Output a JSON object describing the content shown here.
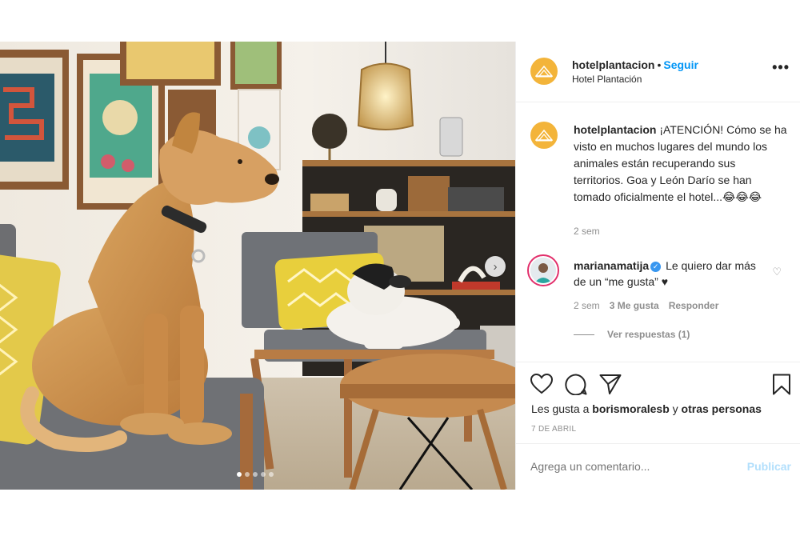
{
  "post": {
    "username": "hotelplantacion",
    "separator": "•",
    "follow_label": "Seguir",
    "location": "Hotel Plantación",
    "more_icon": "more-options-icon"
  },
  "caption": {
    "username": "hotelplantacion",
    "text": "¡ATENCIÓN! Cómo se ha visto en muchos lugares del mundo los animales están recuperando sus territorios. Goa y León Darío se han tomado oficialmente el hotel...😂😂😂",
    "time": "2 sem"
  },
  "comment": {
    "username": "marianamatija",
    "text": "Le quiero dar más de un “me gusta” ♥",
    "time": "2 sem",
    "likes": "3 Me gusta",
    "reply": "Responder",
    "view_replies": "Ver respuestas (1)"
  },
  "actions": {
    "likes_prefix": "Les gusta a",
    "liked_by": "borismoralesb",
    "conj": "y",
    "others": "otras personas",
    "date": "7 DE ABRIL"
  },
  "add_comment": {
    "placeholder": "Agrega un comentario...",
    "publish": "Publicar"
  },
  "photo": {
    "carousel_count": 5,
    "carousel_active": 0,
    "next_icon": "chevron-right-icon"
  },
  "colors": {
    "link": "#0095f6",
    "publish_disabled": "#b2dffc",
    "avatar_brand": "#f3b43a",
    "story_ring": "#e2306c"
  }
}
